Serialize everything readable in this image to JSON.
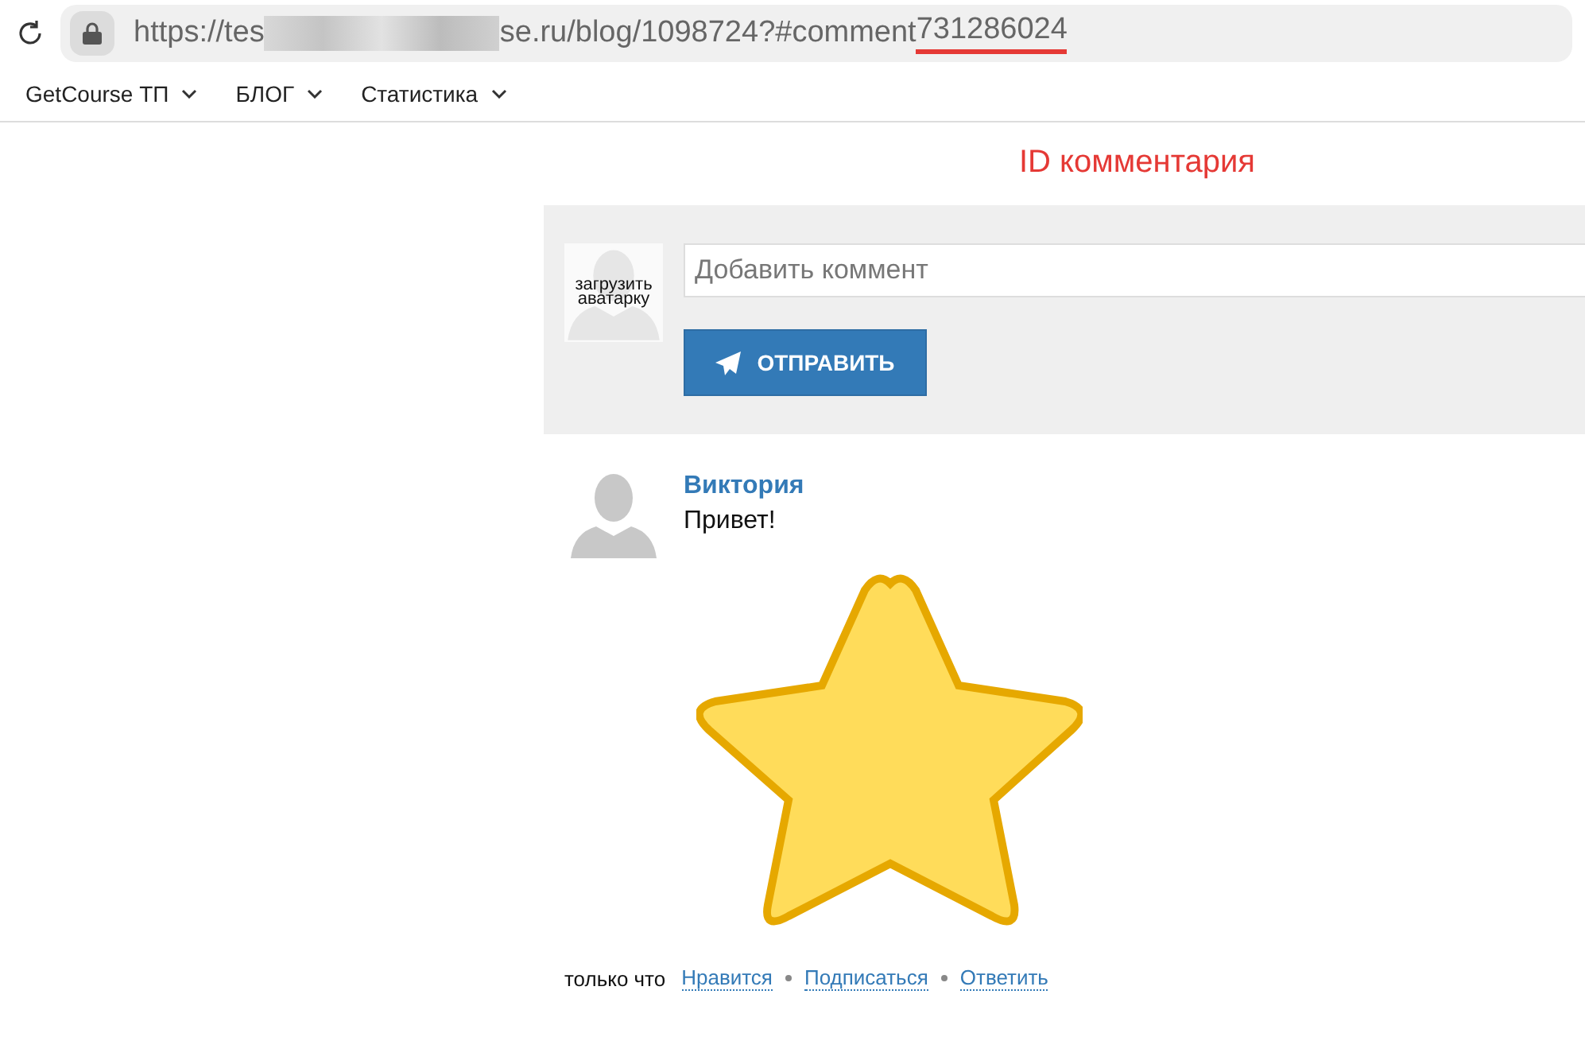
{
  "address_bar": {
    "url_prefix": "https://tes",
    "url_suffix": "se.ru/blog/1098724?#comment",
    "comment_id": "731286024"
  },
  "bookmarks": [
    {
      "label": "GetCourse ТП"
    },
    {
      "label": "БЛОГ"
    },
    {
      "label": "Статистика"
    }
  ],
  "annotation": "ID комментария",
  "comment_form": {
    "avatar_label": "загрузить аватарку",
    "placeholder": "Добавить коммент",
    "submit": "ОТПРАВИТЬ"
  },
  "comment": {
    "author": "Виктория",
    "text": "Привет!",
    "time": "только что",
    "actions": [
      "Нравится",
      "Подписаться",
      "Ответить"
    ]
  }
}
